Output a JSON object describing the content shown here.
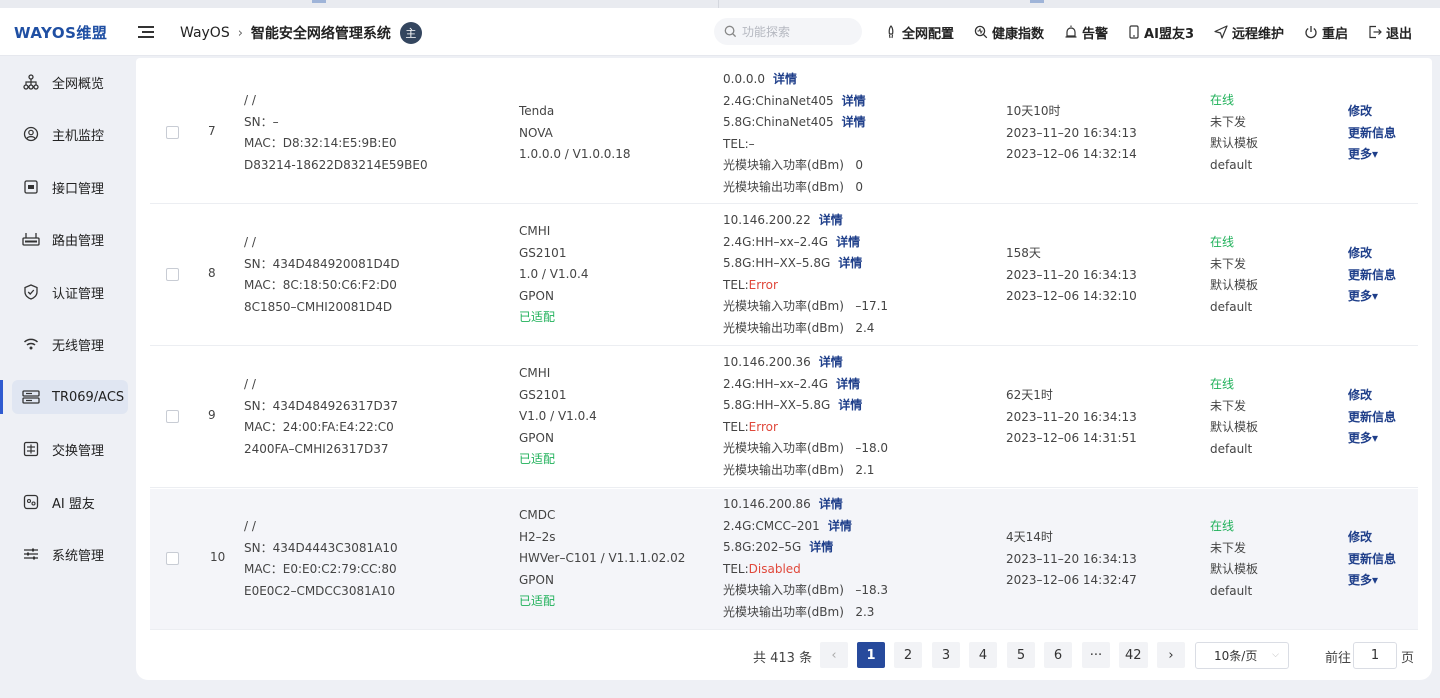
{
  "app": {
    "logo": "WAYOS维盟",
    "breadcrumb": {
      "root": "WayOS",
      "system": "智能安全网络管理系统",
      "badge": "主"
    }
  },
  "search": {
    "placeholder": "功能探索"
  },
  "topnav": [
    {
      "label": "全网配置",
      "icon": "rocket-icon"
    },
    {
      "label": "健康指数",
      "icon": "health-search-icon"
    },
    {
      "label": "告警",
      "icon": "alarm-icon"
    },
    {
      "label": "AI盟友3",
      "icon": "phone-icon"
    },
    {
      "label": "远程维护",
      "icon": "send-icon"
    },
    {
      "label": "重启",
      "icon": "power-icon"
    },
    {
      "label": "退出",
      "icon": "logout-icon"
    }
  ],
  "sidebar": {
    "items": [
      {
        "label": "全网概览",
        "icon": "network-tree-icon"
      },
      {
        "label": "主机监控",
        "icon": "user-circle-icon"
      },
      {
        "label": "接口管理",
        "icon": "interface-icon"
      },
      {
        "label": "路由管理",
        "icon": "router-icon"
      },
      {
        "label": "认证管理",
        "icon": "shield-check-icon"
      },
      {
        "label": "无线管理",
        "icon": "wifi-icon"
      },
      {
        "label": "TR069/ACS",
        "icon": "server-icon",
        "active": true
      },
      {
        "label": "交换管理",
        "icon": "switch-icon"
      },
      {
        "label": "AI 盟友",
        "icon": "ai-icon"
      },
      {
        "label": "系统管理",
        "icon": "sliders-icon"
      }
    ]
  },
  "table": {
    "rows": [
      {
        "num": "7",
        "name": "/ /",
        "sn": "SN：–",
        "mac": "MAC：D8:32:14:E5:9B:E0",
        "id": "D83214-18622D83214E59BE0",
        "device": [
          "Tenda",
          "NOVA",
          "1.0.0.0 / V1.0.0.18"
        ],
        "adapted": "",
        "net": {
          "ip": "0.0.0.0",
          "wifi24": "2.4G:ChinaNet405",
          "wifi5": "5.8G:ChinaNet405",
          "tel_prefix": "TEL:",
          "tel": "–",
          "tel_error": false,
          "rx": "光模块输入功率(dBm)   0",
          "tx": "光模块输出功率(dBm)   0"
        },
        "detail": "详情",
        "time": [
          "10天10时",
          "2023–11–20 16:34:13",
          "2023–12–06 14:32:14"
        ],
        "status": [
          "在线",
          "未下发",
          "默认模板",
          "default"
        ],
        "ops": [
          "修改",
          "更新信息",
          "更多▾"
        ]
      },
      {
        "num": "8",
        "name": "/ /",
        "sn": "SN：434D484920081D4D",
        "mac": "MAC：8C:18:50:C6:F2:D0",
        "id": "8C1850–CMHI20081D4D",
        "device": [
          "CMHI",
          "GS2101",
          "1.0 / V1.0.4",
          "GPON"
        ],
        "adapted": "已适配",
        "net": {
          "ip": "10.146.200.22",
          "wifi24": "2.4G:HH–xx–2.4G",
          "wifi5": "5.8G:HH–XX–5.8G",
          "tel_prefix": "TEL:",
          "tel": "Error",
          "tel_error": true,
          "rx": "光模块输入功率(dBm)   –17.1",
          "tx": "光模块输出功率(dBm)   2.4"
        },
        "detail": "详情",
        "time": [
          "158天",
          "2023–11–20 16:34:13",
          "2023–12–06 14:32:10"
        ],
        "status": [
          "在线",
          "未下发",
          "默认模板",
          "default"
        ],
        "ops": [
          "修改",
          "更新信息",
          "更多▾"
        ]
      },
      {
        "num": "9",
        "name": "/ /",
        "sn": "SN：434D484926317D37",
        "mac": "MAC：24:00:FA:E4:22:C0",
        "id": "2400FA–CMHI26317D37",
        "device": [
          "CMHI",
          "GS2101",
          "V1.0 / V1.0.4",
          "GPON"
        ],
        "adapted": "已适配",
        "net": {
          "ip": "10.146.200.36",
          "wifi24": "2.4G:HH–xx–2.4G",
          "wifi5": "5.8G:HH–XX–5.8G",
          "tel_prefix": "TEL:",
          "tel": "Error",
          "tel_error": true,
          "rx": "光模块输入功率(dBm)   –18.0",
          "tx": "光模块输出功率(dBm)   2.1"
        },
        "detail": "详情",
        "time": [
          "62天1时",
          "2023–11–20 16:34:13",
          "2023–12–06 14:31:51"
        ],
        "status": [
          "在线",
          "未下发",
          "默认模板",
          "default"
        ],
        "ops": [
          "修改",
          "更新信息",
          "更多▾"
        ]
      },
      {
        "num": "10",
        "name": "/ /",
        "sn": "SN：434D4443C3081A10",
        "mac": "MAC：E0:E0:C2:79:CC:80",
        "id": "E0E0C2–CMDCC3081A10",
        "device": [
          "CMDC",
          "H2–2s",
          "HWVer–C101 / V1.1.1.02.02",
          "GPON"
        ],
        "adapted": "已适配",
        "net": {
          "ip": "10.146.200.86",
          "wifi24": "2.4G:CMCC–201",
          "wifi5": "5.8G:202–5G",
          "tel_prefix": "TEL:",
          "tel": "Disabled",
          "tel_error": true,
          "rx": "光模块输入功率(dBm)   –18.3",
          "tx": "光模块输出功率(dBm)   2.3"
        },
        "detail": "详情",
        "time": [
          "4天14时",
          "2023–11–20 16:34:13",
          "2023–12–06 14:32:47"
        ],
        "status": [
          "在线",
          "未下发",
          "默认模板",
          "default"
        ],
        "ops": [
          "修改",
          "更新信息",
          "更多▾"
        ]
      }
    ]
  },
  "pagination": {
    "total": "共 413 条",
    "prev": "‹",
    "pages": [
      "1",
      "2",
      "3",
      "4",
      "5",
      "6",
      "···",
      "42"
    ],
    "current": "1",
    "next": "›",
    "page_size": "10条/页",
    "goto_prefix": "前往",
    "goto_value": "1",
    "goto_suffix": "页"
  },
  "colors": {
    "accent": "#274a9c",
    "link": "#1f3f8a",
    "online": "#20b15a",
    "error": "#e0483b"
  }
}
